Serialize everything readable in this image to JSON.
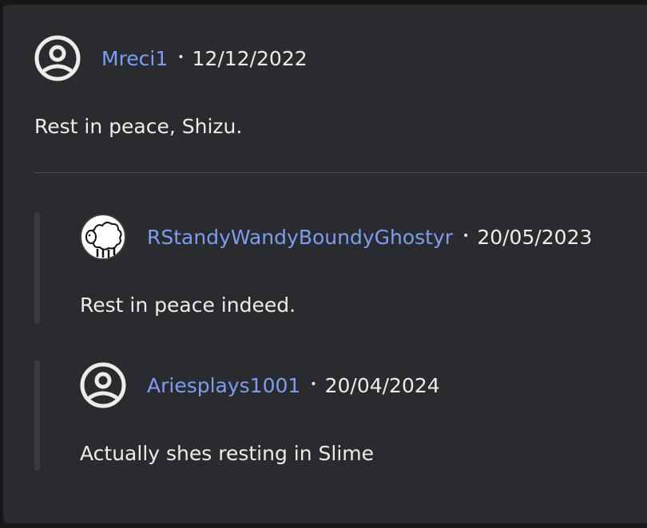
{
  "comments": [
    {
      "username": "Mreci1",
      "separator": "•",
      "date": "12/12/2022",
      "text": "Rest in peace, Shizu.",
      "avatar": "default-user-icon"
    }
  ],
  "replies": [
    {
      "username": "RStandyWandyBoundyGhostyr",
      "separator": "•",
      "date": "20/05/2023",
      "text": "Rest in peace indeed.",
      "avatar": "sheep-avatar"
    },
    {
      "username": "Ariesplays1001",
      "separator": "•",
      "date": "20/04/2024",
      "text": "Actually shes resting in Slime",
      "avatar": "default-user-icon"
    }
  ],
  "colors": {
    "background": "#2a2b2e",
    "username": "#7b9df2",
    "text": "#ececec",
    "thread_line": "#3a3b3f"
  }
}
